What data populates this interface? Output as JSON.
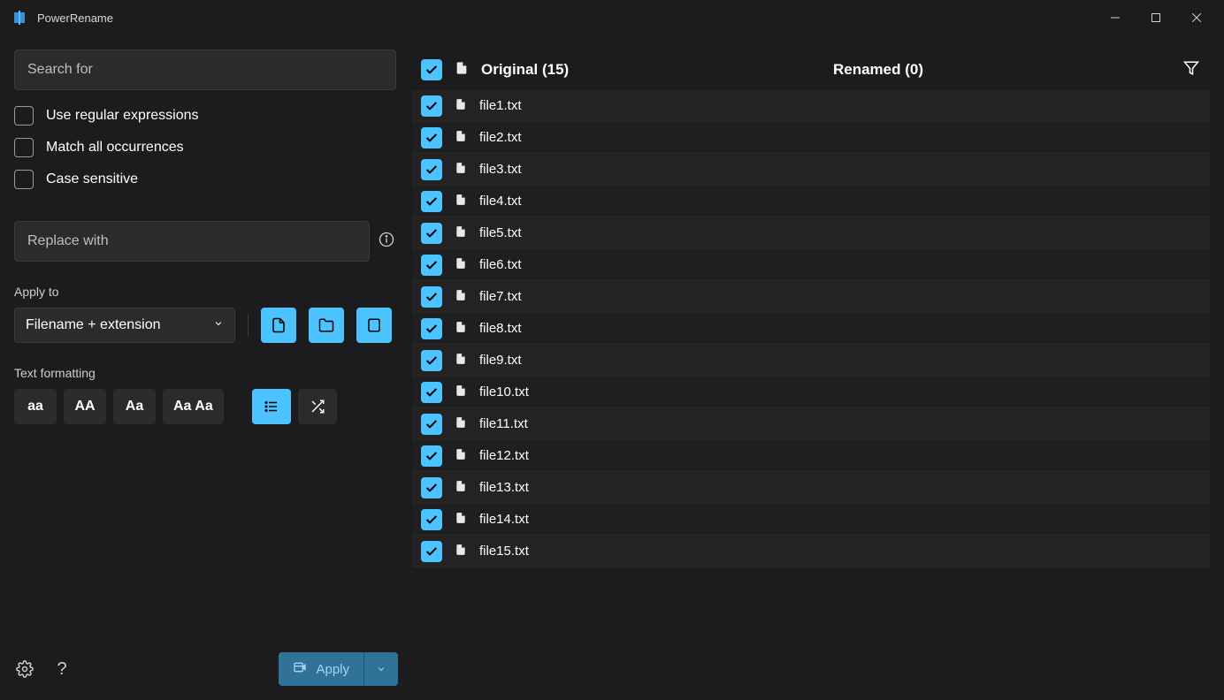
{
  "window": {
    "title": "PowerRename"
  },
  "search": {
    "placeholder": "Search for",
    "value": ""
  },
  "options": {
    "regex": "Use regular expressions",
    "match_all": "Match all occurrences",
    "case_sensitive": "Case sensitive"
  },
  "replace": {
    "placeholder": "Replace with",
    "value": ""
  },
  "apply_to": {
    "label": "Apply to",
    "selected": "Filename + extension"
  },
  "text_formatting": {
    "label": "Text formatting",
    "lowercase": "aa",
    "uppercase": "AA",
    "titlecase": "Aa",
    "capitalize": "Aa Aa"
  },
  "apply_button": "Apply",
  "list": {
    "original_label": "Original (15)",
    "renamed_label": "Renamed (0)",
    "files": [
      {
        "name": "file1.txt"
      },
      {
        "name": "file2.txt"
      },
      {
        "name": "file3.txt"
      },
      {
        "name": "file4.txt"
      },
      {
        "name": "file5.txt"
      },
      {
        "name": "file6.txt"
      },
      {
        "name": "file7.txt"
      },
      {
        "name": "file8.txt"
      },
      {
        "name": "file9.txt"
      },
      {
        "name": "file10.txt"
      },
      {
        "name": "file11.txt"
      },
      {
        "name": "file12.txt"
      },
      {
        "name": "file13.txt"
      },
      {
        "name": "file14.txt"
      },
      {
        "name": "file15.txt"
      }
    ]
  }
}
